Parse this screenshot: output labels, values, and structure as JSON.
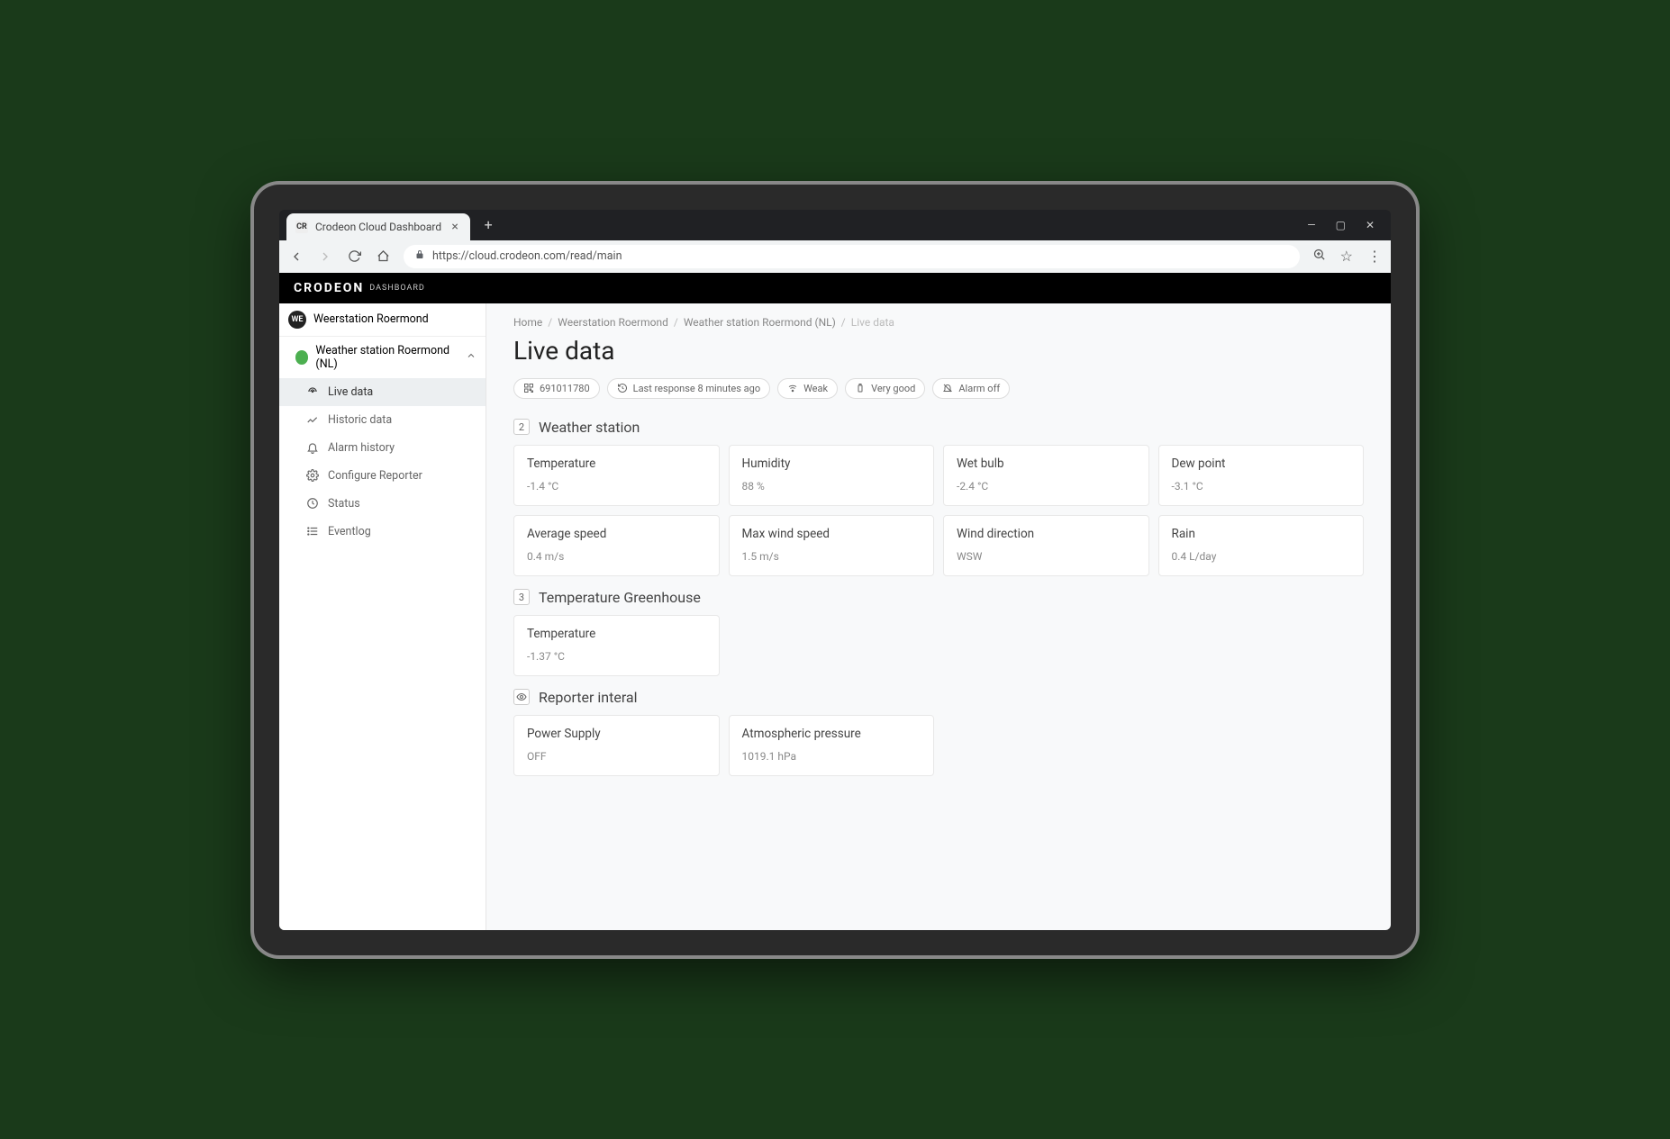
{
  "browser": {
    "tab_title": "Crodeon Cloud Dashboard",
    "url": "https://cloud.crodeon.com/read/main"
  },
  "brand": {
    "name": "CRODEON",
    "sub": "DASHBOARD"
  },
  "sidebar": {
    "root_label": "Weerstation Roermond",
    "root_avatar": "WE",
    "station_label": "Weather station Roermond (NL)",
    "items": [
      {
        "label": "Live data"
      },
      {
        "label": "Historic data"
      },
      {
        "label": "Alarm history"
      },
      {
        "label": "Configure Reporter"
      },
      {
        "label": "Status"
      },
      {
        "label": "Eventlog"
      }
    ]
  },
  "breadcrumbs": {
    "items": [
      "Home",
      "Weerstation Roermond",
      "Weather station Roermond (NL)",
      "Live data"
    ]
  },
  "page_title": "Live data",
  "pills": {
    "device_id": "691011780",
    "last_response": "Last response 8 minutes ago",
    "signal": "Weak",
    "battery": "Very good",
    "alarm": "Alarm off"
  },
  "sections": [
    {
      "badge": "2",
      "title": "Weather station",
      "cards": [
        {
          "label": "Temperature",
          "value": "-1.4 °C"
        },
        {
          "label": "Humidity",
          "value": "88 %"
        },
        {
          "label": "Wet bulb",
          "value": "-2.4 °C"
        },
        {
          "label": "Dew point",
          "value": "-3.1 °C"
        },
        {
          "label": "Average speed",
          "value": "0.4 m/s"
        },
        {
          "label": "Max wind speed",
          "value": "1.5 m/s"
        },
        {
          "label": "Wind direction",
          "value": "WSW"
        },
        {
          "label": "Rain",
          "value": "0.4 L/day"
        }
      ]
    },
    {
      "badge": "3",
      "title": "Temperature Greenhouse",
      "cards": [
        {
          "label": "Temperature",
          "value": "-1.37 °C"
        }
      ]
    },
    {
      "badge": "eye",
      "title": "Reporter interal",
      "cards": [
        {
          "label": "Power Supply",
          "value": "OFF"
        },
        {
          "label": "Atmospheric pressure",
          "value": "1019.1 hPa"
        }
      ]
    }
  ]
}
